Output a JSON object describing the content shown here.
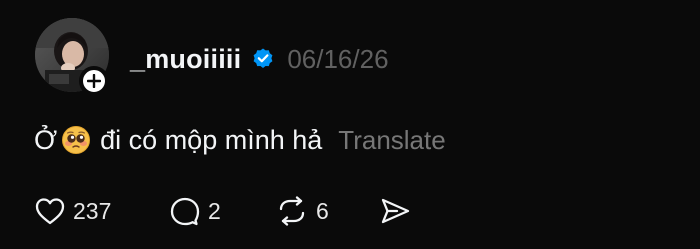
{
  "post": {
    "author": {
      "username": "_muoiiiii",
      "verified": true,
      "avatar_icon": "profile-photo",
      "follow_icon": "plus-icon"
    },
    "date": "06/16/26",
    "text": {
      "part1": "Ở",
      "emoji": "pleading-face-emoji",
      "part2": "đi có mộp mình hả"
    },
    "translate_label": "Translate",
    "actions": {
      "likes": "237",
      "replies": "2",
      "reposts": "6"
    },
    "colors": {
      "background": "#0a0a0a",
      "text": "#f3f5f7",
      "muted": "#616161",
      "verified": "#0095f6"
    }
  }
}
